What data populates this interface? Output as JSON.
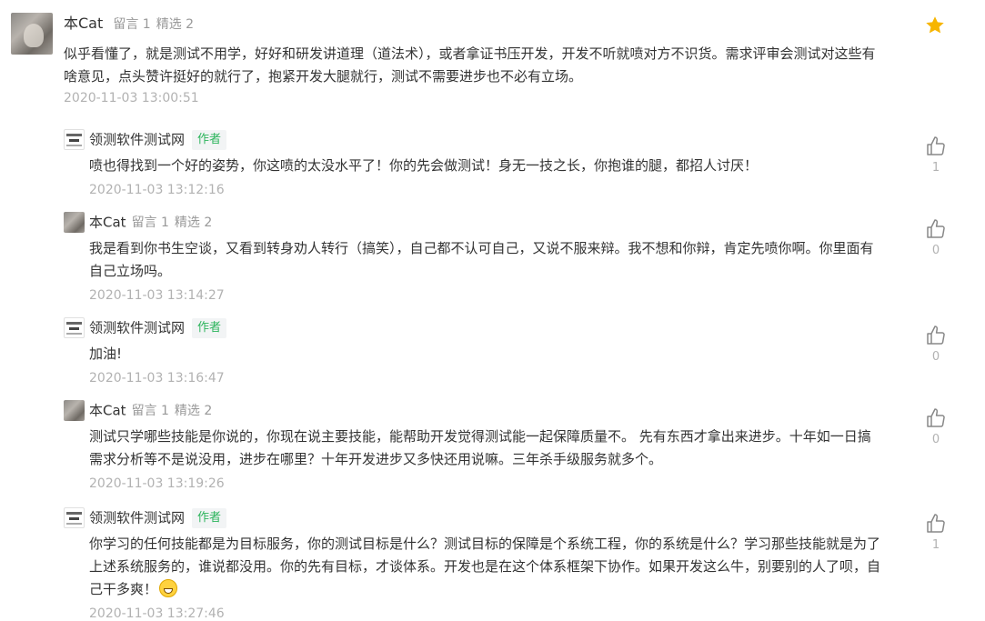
{
  "top": {
    "user": "本Cat",
    "stat_messages": "留言 1",
    "stat_featured": "精选 2",
    "text": "似乎看懂了，就是测试不用学，好好和研发讲道理（道法术），或者拿证书压开发，开发不听就喷对方不识货。需求评审会测试对这些有啥意见，点头赞许挺好的就行了，抱紧开发大腿就行，测试不需要进步也不必有立场。",
    "time": "2020-11-03 13:00:51",
    "star_color": "#f7b500"
  },
  "replies": [
    {
      "user": "领测软件测试网",
      "author_tag": "作者",
      "text": "喷也得找到一个好的姿势，你这喷的太没水平了！你的先会做测试！身无一技之长，你抱谁的腿，都招人讨厌！",
      "time": "2020-11-03 13:12:16",
      "likes": "1"
    },
    {
      "user": "本Cat",
      "stat_messages": "留言 1",
      "stat_featured": "精选 2",
      "text": "我是看到你书生空谈，又看到转身劝人转行（搞笑），自己都不认可自己，又说不服来辩。我不想和你辩，肯定先喷你啊。你里面有自己立场吗。",
      "time": "2020-11-03 13:14:27",
      "likes": "0"
    },
    {
      "user": "领测软件测试网",
      "author_tag": "作者",
      "text": "加油!",
      "time": "2020-11-03 13:16:47",
      "likes": "0"
    },
    {
      "user": "本Cat",
      "stat_messages": "留言 1",
      "stat_featured": "精选 2",
      "text": "测试只学哪些技能是你说的，你现在说主要技能，能帮助开发觉得测试能一起保障质量不。 先有东西才拿出来进步。十年如一日搞需求分析等不是说没用，进步在哪里？十年开发进步又多快还用说嘛。三年杀手级服务就多个。",
      "time": "2020-11-03 13:19:26",
      "likes": "0"
    },
    {
      "user": "领测软件测试网",
      "author_tag": "作者",
      "text": "你学习的任何技能都是为目标服务，你的测试目标是什么？测试目标的保障是个系统工程，你的系统是什么？学习那些技能就是为了上述系统服务的，谁说都没用。你的先有目标，才谈体系。开发也是在这个体系框架下协作。如果开发这么牛，别要别的人了呗，自己干多爽！",
      "time": "2020-11-03 13:27:46",
      "likes": "1"
    }
  ],
  "colors": {
    "author_tag": "#2db55d",
    "muted": "#b2b2b2",
    "text": "#333333"
  },
  "icons": {
    "star": "star-icon",
    "like": "thumbs-up-icon",
    "emoji": "grinning-emoji"
  }
}
